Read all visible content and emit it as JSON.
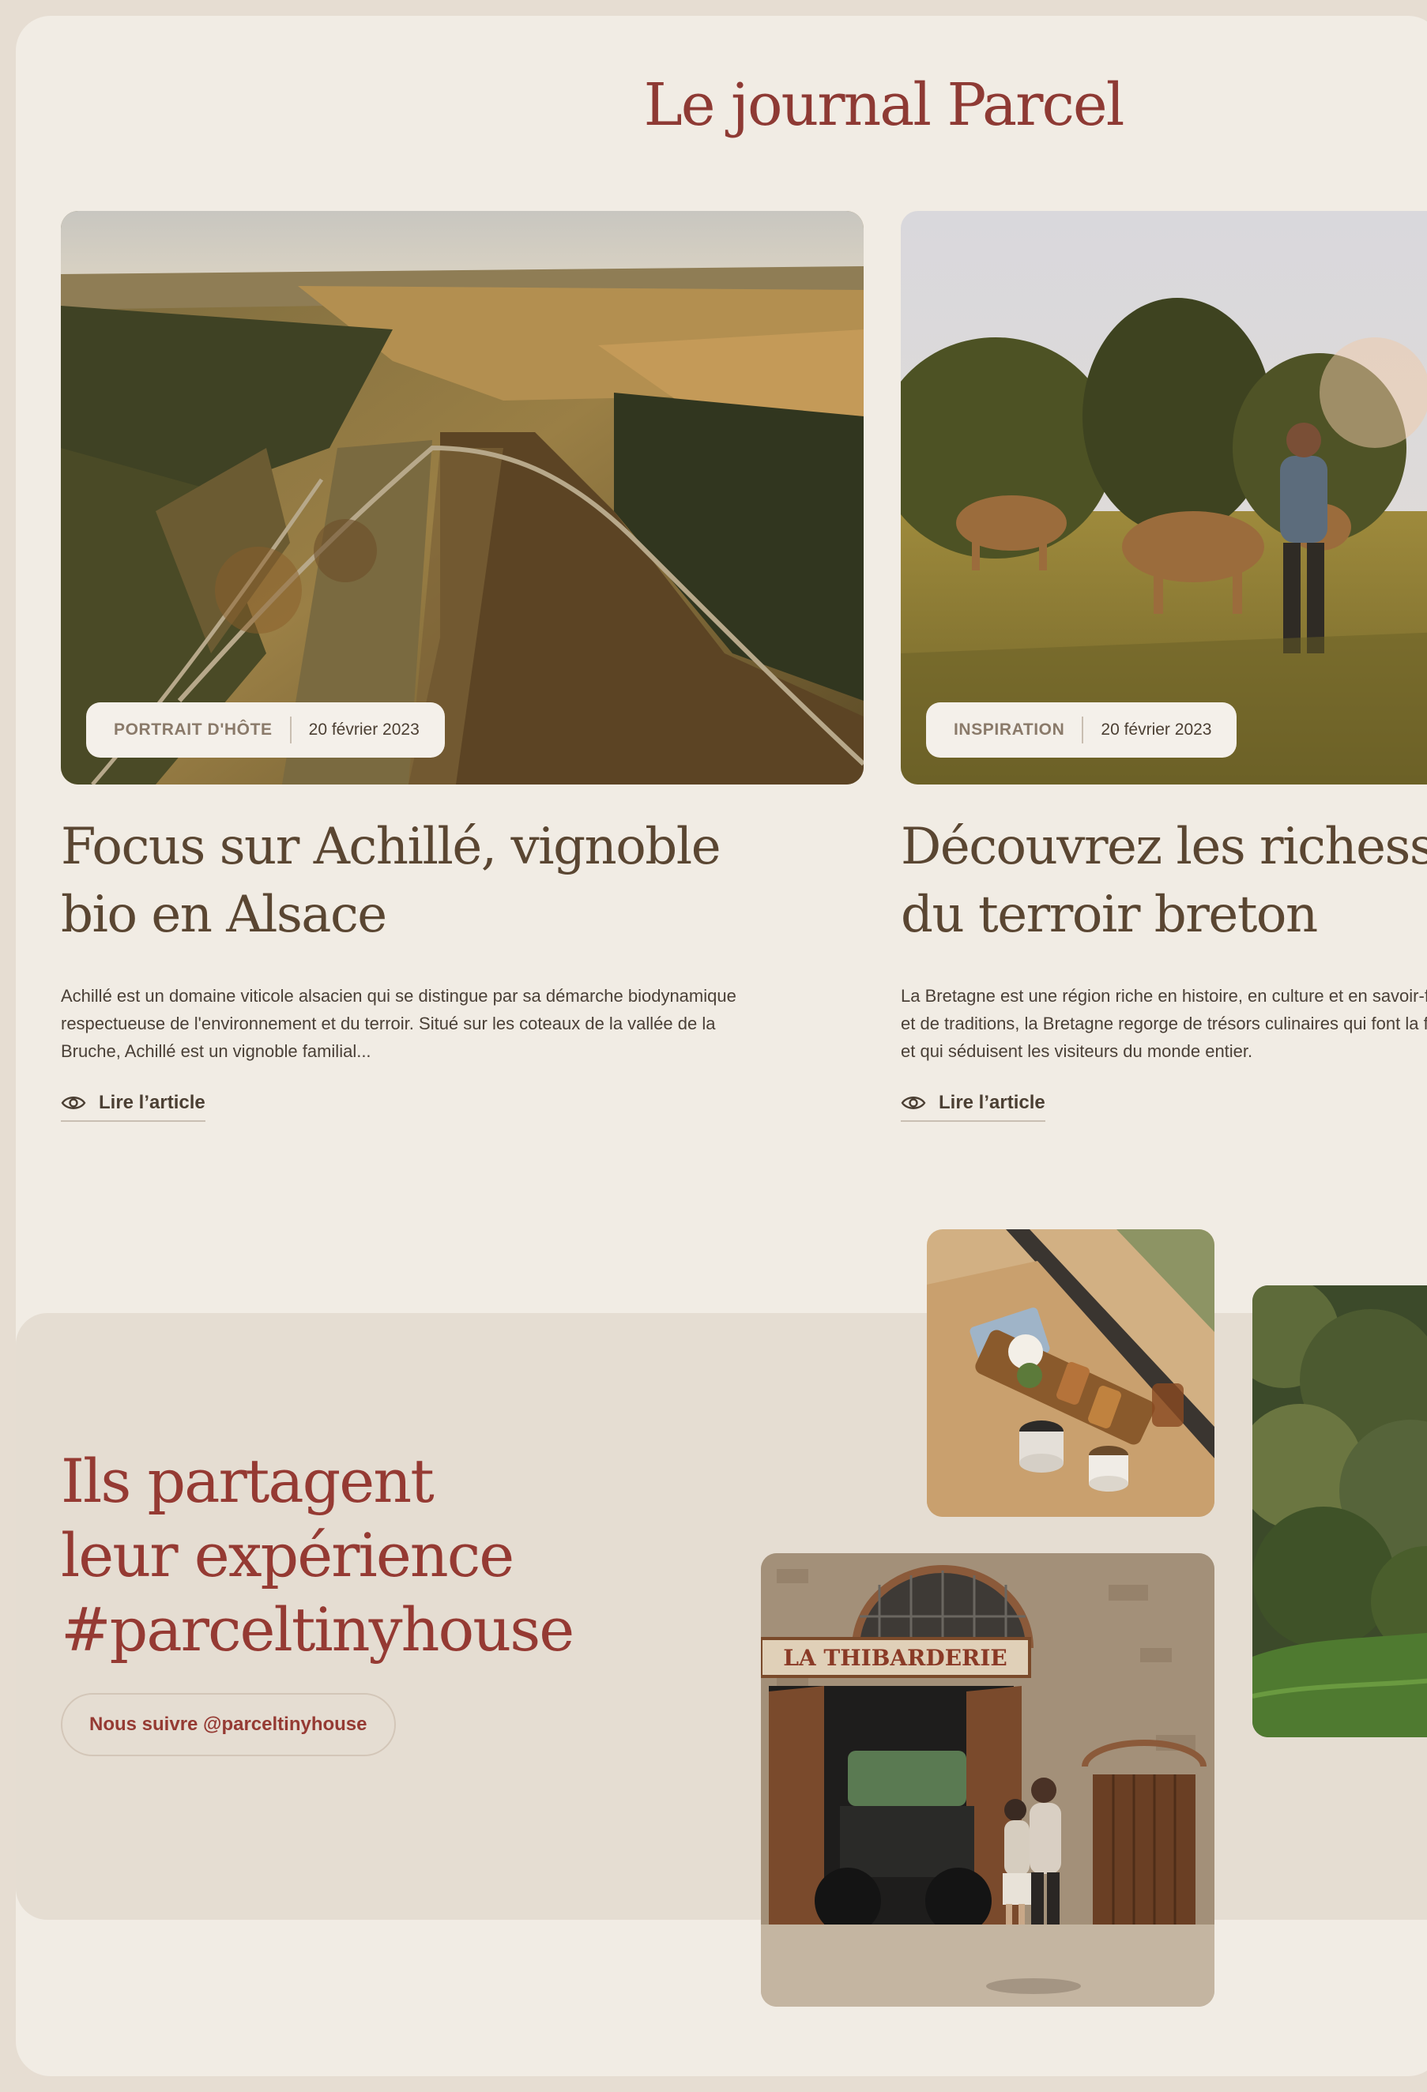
{
  "journal": {
    "title": "Le journal Parcel"
  },
  "articles": [
    {
      "category": "PORTRAIT D'HÔTE",
      "date": "20 février 2023",
      "title": "Focus sur Achillé, vignoble\nbio en Alsace",
      "excerpt": "Achillé est un domaine viticole alsacien qui se distingue par sa démarche biodynamique respectueuse de l'environnement et du terroir. Situé sur les coteaux de la vallée de la Bruche, Achillé est un vignoble familial...",
      "link_label": "Lire l’article",
      "image_icon": "aerial-vineyard-photo"
    },
    {
      "category": "INSPIRATION",
      "date": "20 février 2023",
      "title": "Découvrez les richesses\ndu terroir breton",
      "excerpt": "La Bretagne est une région riche en histoire, en culture et en savoir-faire. Terre de légendes et de traditions, la Bretagne regorge de trésors culinaires qui font la fierté de ses habitants et qui séduisent les visiteurs du monde entier.",
      "link_label": "Lire l’article",
      "image_icon": "cows-in-pasture-photo"
    }
  ],
  "share": {
    "heading": "Ils partagent\nleur expérience\n#parceltinyhouse",
    "follow_label": "Nous suivre @parceltinyhouse",
    "barn_sign": "LA THIBARDERIE"
  },
  "colors": {
    "page_background": "#f1ece4",
    "band_background": "#e5ddd2",
    "accent_red": "#953a33",
    "title_brown": "#5a4632"
  },
  "icons": {
    "read_icon": "eye-icon"
  }
}
